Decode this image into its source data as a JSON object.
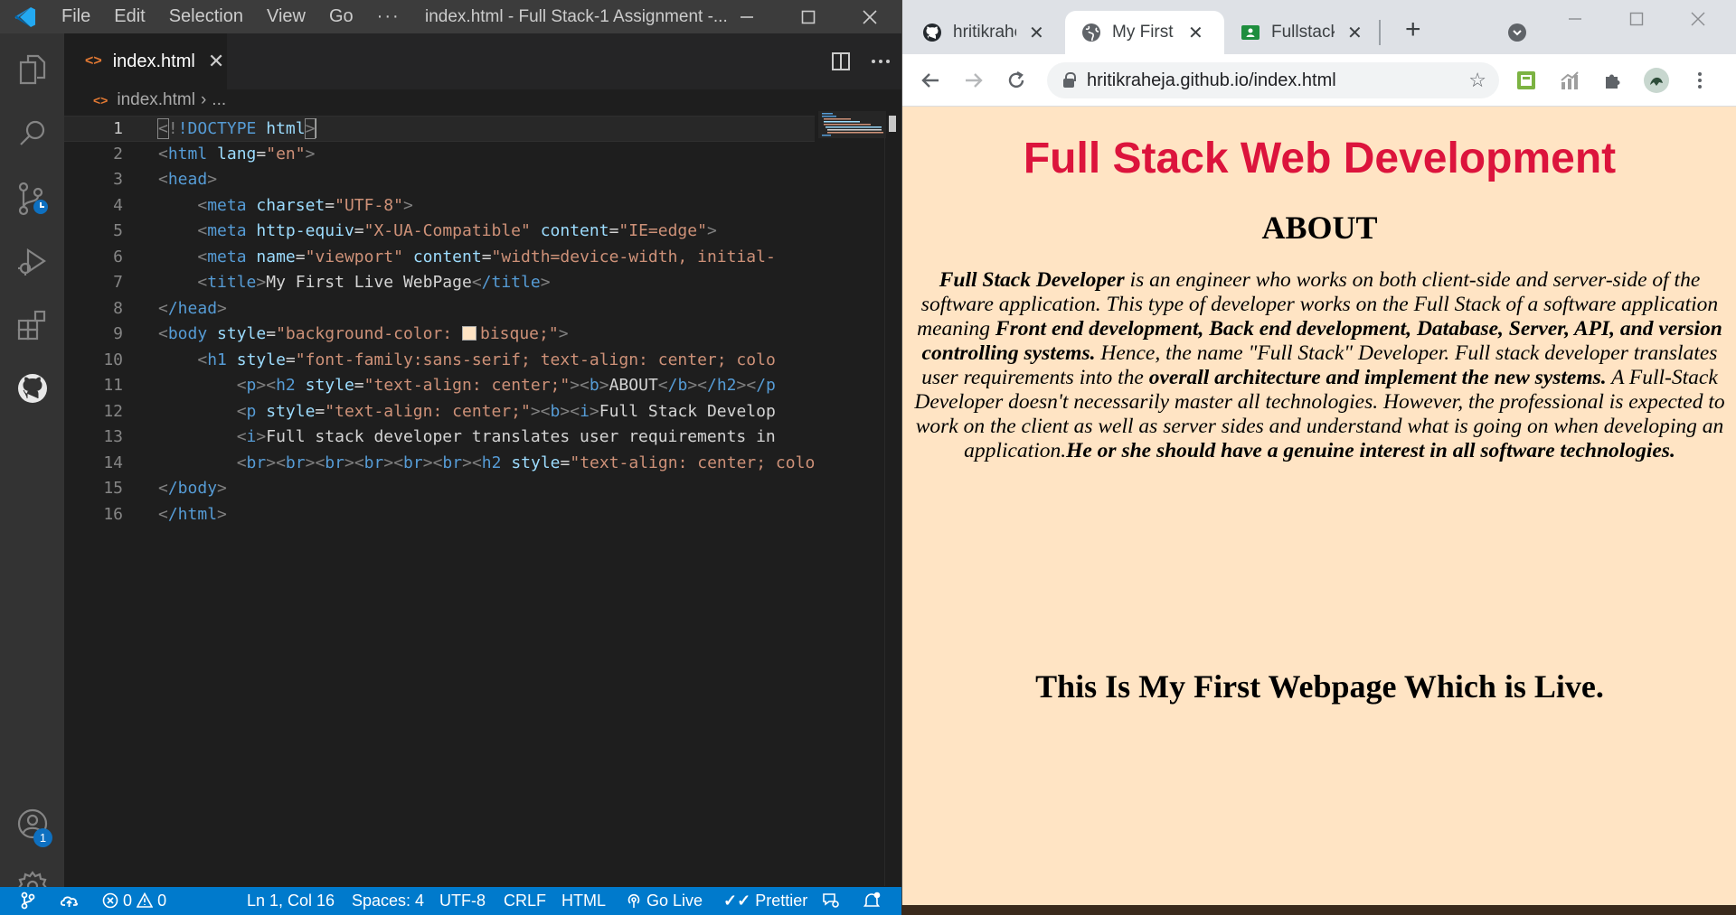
{
  "vscode": {
    "menu": [
      "File",
      "Edit",
      "Selection",
      "View",
      "Go",
      "···"
    ],
    "window_title": "index.html - Full Stack-1 Assignment -...",
    "tab": {
      "label": "index.html",
      "close": "✕"
    },
    "breadcrumb": {
      "file": "index.html",
      "sep": "›",
      "rest": "..."
    },
    "activity": {
      "accounts_badge": "1"
    },
    "lines": [
      "1",
      "2",
      "3",
      "4",
      "5",
      "6",
      "7",
      "8",
      "9",
      "10",
      "11",
      "12",
      "13",
      "14",
      "15",
      "16"
    ],
    "code": {
      "l1_doctype": "!DOCTYPE",
      "l1_html": "html",
      "l2_tag": "html",
      "l2_attr": "lang",
      "l2_val": "\"en\"",
      "l3_tag": "head",
      "l4_tag": "meta",
      "l4_attr": "charset",
      "l4_val": "\"UTF-8\"",
      "l5_tag": "meta",
      "l5_attr1": "http-equiv",
      "l5_val1": "\"X-UA-Compatible\"",
      "l5_attr2": "content",
      "l5_val2": "\"IE=edge\"",
      "l6_tag": "meta",
      "l6_attr1": "name",
      "l6_val1": "\"viewport\"",
      "l6_attr2": "content",
      "l6_val2": "\"width=device-width, initial-",
      "l7_tag": "title",
      "l7_text": "My First Live WebPage",
      "l7_close": "/title",
      "l8_tag": "/head",
      "l9_tag": "body",
      "l9_attr": "style",
      "l9_val1": "\"background-color: ",
      "l9_val2": "bisque;\"",
      "l10_tag": "h1",
      "l10_attr": "style",
      "l10_val": "\"font-family:sans-serif; text-align: center; colo",
      "l11_p": "p",
      "l11_h2": "h2",
      "l11_attr": "style",
      "l11_val": "\"text-align: center;\"",
      "l11_b": "b",
      "l11_text": "ABOUT",
      "l11_bc": "/b",
      "l11_h2c": "/h2",
      "l11_pc": "/p",
      "l12_p": "p",
      "l12_attr": "style",
      "l12_val": "\"text-align: center;\"",
      "l12_b": "b",
      "l12_i": "i",
      "l12_text": "Full Stack Develop",
      "l13_i": "i",
      "l13_text": "Full stack developer translates user requirements in",
      "l14_br": "br",
      "l14_h2": "h2",
      "l14_attr": "style",
      "l14_val": "\"text-align: center; colo",
      "l15_tag": "/body",
      "l16_tag": "/html"
    },
    "status": {
      "problems_errors": "0",
      "problems_warnings": "0",
      "position": "Ln 1, Col 16",
      "spaces": "Spaces: 4",
      "encoding": "UTF-8",
      "eol": "CRLF",
      "language": "HTML",
      "golive": "Go Live",
      "prettier": "Prettier"
    },
    "colors": {
      "statusbar": "#007acc",
      "bisque_swatch": "#ffe4c4"
    }
  },
  "chrome": {
    "tabs": [
      {
        "title": "hritikrahe",
        "icon": "github-icon"
      },
      {
        "title": "My First L",
        "icon": "globe-icon"
      },
      {
        "title": "Fullstack I",
        "icon": "classroom-icon"
      }
    ],
    "new_tab": "+",
    "url": "hritikraheja.github.io/index.html",
    "page": {
      "h1": "Full Stack Web Development",
      "h2": "ABOUT",
      "p_s1": "Full Stack Developer",
      "p_s2": " is an engineer who works on both client-side and server-side of the software application. This type of developer works on the Full Stack of a software application meaning ",
      "p_s3": "Front end development, Back end development, Database, Server, API, and version controlling systems.",
      "p_s4": " Hence, the name \"Full Stack\" Developer. Full stack developer translates user requirements into the ",
      "p_s5": "overall architecture and implement the new systems.",
      "p_s6": " A Full-Stack Developer doesn't necessarily master all technologies. However, the professional is expected to work on the client as well as server sides and understand what is going on when developing an application.",
      "p_s7": "He or she should have a genuine interest in all software technologies.",
      "h2b": "This Is My First Webpage Which is Live."
    },
    "colors": {
      "page_bg": "#ffe4c4",
      "h1": "#dc143c"
    }
  }
}
